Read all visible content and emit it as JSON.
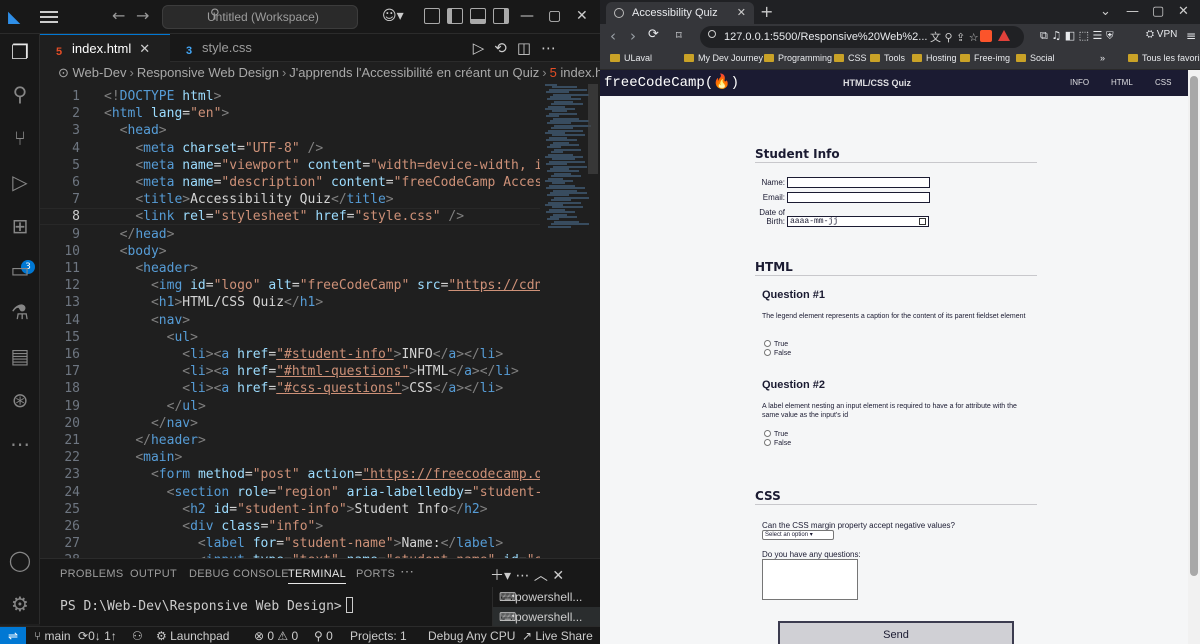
{
  "vscode": {
    "search_text": "Untitled (Workspace)",
    "tabs": [
      {
        "label": "index.html",
        "active": true
      },
      {
        "label": "style.css",
        "active": false
      }
    ],
    "breadcrumb": [
      "Web-Dev",
      "Responsive Web Design",
      "J'apprends l'Accessibilité en créant un Quiz",
      "index.html"
    ],
    "extensions_badge": "3",
    "current_line": 8,
    "code_lines": [
      {
        "n": "1",
        "parts": [
          [
            "br",
            "<!"
          ],
          [
            "tag",
            "DOCTYPE"
          ],
          [
            "txt",
            " "
          ],
          [
            "attr",
            "html"
          ],
          [
            "br",
            ">"
          ]
        ]
      },
      {
        "n": "2",
        "parts": [
          [
            "br",
            "<"
          ],
          [
            "tag",
            "html"
          ],
          [
            "txt",
            " "
          ],
          [
            "attr",
            "lang"
          ],
          [
            "txt",
            "="
          ],
          [
            "str",
            "\"en\""
          ],
          [
            "br",
            ">"
          ]
        ]
      },
      {
        "n": "3",
        "parts": [
          [
            "txt",
            "  "
          ],
          [
            "br",
            "<"
          ],
          [
            "tag",
            "head"
          ],
          [
            "br",
            ">"
          ]
        ]
      },
      {
        "n": "4",
        "parts": [
          [
            "txt",
            "    "
          ],
          [
            "br",
            "<"
          ],
          [
            "tag",
            "meta"
          ],
          [
            "txt",
            " "
          ],
          [
            "attr",
            "charset"
          ],
          [
            "txt",
            "="
          ],
          [
            "str",
            "\"UTF-8\""
          ],
          [
            "txt",
            " "
          ],
          [
            "br",
            "/>"
          ]
        ]
      },
      {
        "n": "5",
        "parts": [
          [
            "txt",
            "    "
          ],
          [
            "br",
            "<"
          ],
          [
            "tag",
            "meta"
          ],
          [
            "txt",
            " "
          ],
          [
            "attr",
            "name"
          ],
          [
            "txt",
            "="
          ],
          [
            "str",
            "\"viewport\""
          ],
          [
            "txt",
            " "
          ],
          [
            "attr",
            "content"
          ],
          [
            "txt",
            "="
          ],
          [
            "str",
            "\"width=device-width, initial-"
          ]
        ]
      },
      {
        "n": "6",
        "parts": [
          [
            "txt",
            "    "
          ],
          [
            "br",
            "<"
          ],
          [
            "tag",
            "meta"
          ],
          [
            "txt",
            " "
          ],
          [
            "attr",
            "name"
          ],
          [
            "txt",
            "="
          ],
          [
            "str",
            "\"description\""
          ],
          [
            "txt",
            " "
          ],
          [
            "attr",
            "content"
          ],
          [
            "txt",
            "="
          ],
          [
            "str",
            "\"freeCodeCamp Accessibilit"
          ]
        ]
      },
      {
        "n": "7",
        "parts": [
          [
            "txt",
            "    "
          ],
          [
            "br",
            "<"
          ],
          [
            "tag",
            "title"
          ],
          [
            "br",
            ">"
          ],
          [
            "txt",
            "Accessibility Quiz"
          ],
          [
            "br",
            "</"
          ],
          [
            "tag",
            "title"
          ],
          [
            "br",
            ">"
          ]
        ]
      },
      {
        "n": "8",
        "parts": [
          [
            "txt",
            "    "
          ],
          [
            "br",
            "<"
          ],
          [
            "tag",
            "link"
          ],
          [
            "txt",
            " "
          ],
          [
            "attr",
            "rel"
          ],
          [
            "txt",
            "="
          ],
          [
            "str",
            "\"stylesheet\""
          ],
          [
            "txt",
            " "
          ],
          [
            "attr",
            "href"
          ],
          [
            "txt",
            "="
          ],
          [
            "str",
            "\"style.css\""
          ],
          [
            "txt",
            " "
          ],
          [
            "br",
            "/>"
          ]
        ]
      },
      {
        "n": "9",
        "parts": [
          [
            "txt",
            "  "
          ],
          [
            "br",
            "</"
          ],
          [
            "tag",
            "head"
          ],
          [
            "br",
            ">"
          ]
        ]
      },
      {
        "n": "10",
        "parts": [
          [
            "txt",
            "  "
          ],
          [
            "br",
            "<"
          ],
          [
            "tag",
            "body"
          ],
          [
            "br",
            ">"
          ]
        ]
      },
      {
        "n": "11",
        "parts": [
          [
            "txt",
            "    "
          ],
          [
            "br",
            "<"
          ],
          [
            "tag",
            "header"
          ],
          [
            "br",
            ">"
          ]
        ]
      },
      {
        "n": "12",
        "parts": [
          [
            "txt",
            "      "
          ],
          [
            "br",
            "<"
          ],
          [
            "tag",
            "img"
          ],
          [
            "txt",
            " "
          ],
          [
            "attr",
            "id"
          ],
          [
            "txt",
            "="
          ],
          [
            "str",
            "\"logo\""
          ],
          [
            "txt",
            " "
          ],
          [
            "attr",
            "alt"
          ],
          [
            "txt",
            "="
          ],
          [
            "str",
            "\"freeCodeCamp\""
          ],
          [
            "txt",
            " "
          ],
          [
            "attr",
            "src"
          ],
          [
            "txt",
            "="
          ],
          [
            "url",
            "\"https://cdn.freeco"
          ]
        ]
      },
      {
        "n": "13",
        "parts": [
          [
            "txt",
            "      "
          ],
          [
            "br",
            "<"
          ],
          [
            "tag",
            "h1"
          ],
          [
            "br",
            ">"
          ],
          [
            "txt",
            "HTML/CSS Quiz"
          ],
          [
            "br",
            "</"
          ],
          [
            "tag",
            "h1"
          ],
          [
            "br",
            ">"
          ]
        ]
      },
      {
        "n": "14",
        "parts": [
          [
            "txt",
            "      "
          ],
          [
            "br",
            "<"
          ],
          [
            "tag",
            "nav"
          ],
          [
            "br",
            ">"
          ]
        ]
      },
      {
        "n": "15",
        "parts": [
          [
            "txt",
            "        "
          ],
          [
            "br",
            "<"
          ],
          [
            "tag",
            "ul"
          ],
          [
            "br",
            ">"
          ]
        ]
      },
      {
        "n": "16",
        "parts": [
          [
            "txt",
            "          "
          ],
          [
            "br",
            "<"
          ],
          [
            "tag",
            "li"
          ],
          [
            "br",
            "><"
          ],
          [
            "tag",
            "a"
          ],
          [
            "txt",
            " "
          ],
          [
            "attr",
            "href"
          ],
          [
            "txt",
            "="
          ],
          [
            "url",
            "\"#student-info\""
          ],
          [
            "br",
            ">"
          ],
          [
            "txt",
            "INFO"
          ],
          [
            "br",
            "</"
          ],
          [
            "tag",
            "a"
          ],
          [
            "br",
            "></"
          ],
          [
            "tag",
            "li"
          ],
          [
            "br",
            ">"
          ]
        ]
      },
      {
        "n": "17",
        "parts": [
          [
            "txt",
            "          "
          ],
          [
            "br",
            "<"
          ],
          [
            "tag",
            "li"
          ],
          [
            "br",
            "><"
          ],
          [
            "tag",
            "a"
          ],
          [
            "txt",
            " "
          ],
          [
            "attr",
            "href"
          ],
          [
            "txt",
            "="
          ],
          [
            "url",
            "\"#html-questions\""
          ],
          [
            "br",
            ">"
          ],
          [
            "txt",
            "HTML"
          ],
          [
            "br",
            "</"
          ],
          [
            "tag",
            "a"
          ],
          [
            "br",
            "></"
          ],
          [
            "tag",
            "li"
          ],
          [
            "br",
            ">"
          ]
        ]
      },
      {
        "n": "18",
        "parts": [
          [
            "txt",
            "          "
          ],
          [
            "br",
            "<"
          ],
          [
            "tag",
            "li"
          ],
          [
            "br",
            "><"
          ],
          [
            "tag",
            "a"
          ],
          [
            "txt",
            " "
          ],
          [
            "attr",
            "href"
          ],
          [
            "txt",
            "="
          ],
          [
            "url",
            "\"#css-questions\""
          ],
          [
            "br",
            ">"
          ],
          [
            "txt",
            "CSS"
          ],
          [
            "br",
            "</"
          ],
          [
            "tag",
            "a"
          ],
          [
            "br",
            "></"
          ],
          [
            "tag",
            "li"
          ],
          [
            "br",
            ">"
          ]
        ]
      },
      {
        "n": "19",
        "parts": [
          [
            "txt",
            "        "
          ],
          [
            "br",
            "</"
          ],
          [
            "tag",
            "ul"
          ],
          [
            "br",
            ">"
          ]
        ]
      },
      {
        "n": "20",
        "parts": [
          [
            "txt",
            "      "
          ],
          [
            "br",
            "</"
          ],
          [
            "tag",
            "nav"
          ],
          [
            "br",
            ">"
          ]
        ]
      },
      {
        "n": "21",
        "parts": [
          [
            "txt",
            "    "
          ],
          [
            "br",
            "</"
          ],
          [
            "tag",
            "header"
          ],
          [
            "br",
            ">"
          ]
        ]
      },
      {
        "n": "22",
        "parts": [
          [
            "txt",
            "    "
          ],
          [
            "br",
            "<"
          ],
          [
            "tag",
            "main"
          ],
          [
            "br",
            ">"
          ]
        ]
      },
      {
        "n": "23",
        "parts": [
          [
            "txt",
            "      "
          ],
          [
            "br",
            "<"
          ],
          [
            "tag",
            "form"
          ],
          [
            "txt",
            " "
          ],
          [
            "attr",
            "method"
          ],
          [
            "txt",
            "="
          ],
          [
            "str",
            "\"post\""
          ],
          [
            "txt",
            " "
          ],
          [
            "attr",
            "action"
          ],
          [
            "txt",
            "="
          ],
          [
            "url",
            "\"https://freecodecamp.org/prac"
          ]
        ]
      },
      {
        "n": "24",
        "parts": [
          [
            "txt",
            "        "
          ],
          [
            "br",
            "<"
          ],
          [
            "tag",
            "section"
          ],
          [
            "txt",
            " "
          ],
          [
            "attr",
            "role"
          ],
          [
            "txt",
            "="
          ],
          [
            "str",
            "\"region\""
          ],
          [
            "txt",
            " "
          ],
          [
            "attr",
            "aria-labelledby"
          ],
          [
            "txt",
            "="
          ],
          [
            "str",
            "\"student-info\""
          ],
          [
            "br",
            ">"
          ]
        ]
      },
      {
        "n": "25",
        "parts": [
          [
            "txt",
            "          "
          ],
          [
            "br",
            "<"
          ],
          [
            "tag",
            "h2"
          ],
          [
            "txt",
            " "
          ],
          [
            "attr",
            "id"
          ],
          [
            "txt",
            "="
          ],
          [
            "str",
            "\"student-info\""
          ],
          [
            "br",
            ">"
          ],
          [
            "txt",
            "Student Info"
          ],
          [
            "br",
            "</"
          ],
          [
            "tag",
            "h2"
          ],
          [
            "br",
            ">"
          ]
        ]
      },
      {
        "n": "26",
        "parts": [
          [
            "txt",
            "          "
          ],
          [
            "br",
            "<"
          ],
          [
            "tag",
            "div"
          ],
          [
            "txt",
            " "
          ],
          [
            "attr",
            "class"
          ],
          [
            "txt",
            "="
          ],
          [
            "str",
            "\"info\""
          ],
          [
            "br",
            ">"
          ]
        ]
      },
      {
        "n": "27",
        "parts": [
          [
            "txt",
            "            "
          ],
          [
            "br",
            "<"
          ],
          [
            "tag",
            "label"
          ],
          [
            "txt",
            " "
          ],
          [
            "attr",
            "for"
          ],
          [
            "txt",
            "="
          ],
          [
            "str",
            "\"student-name\""
          ],
          [
            "br",
            ">"
          ],
          [
            "txt",
            "Name:"
          ],
          [
            "br",
            "</"
          ],
          [
            "tag",
            "label"
          ],
          [
            "br",
            ">"
          ]
        ]
      },
      {
        "n": "28",
        "parts": [
          [
            "txt",
            "            "
          ],
          [
            "br",
            "<"
          ],
          [
            "tag",
            "input"
          ],
          [
            "txt",
            " "
          ],
          [
            "attr",
            "type"
          ],
          [
            "txt",
            "="
          ],
          [
            "str",
            "\"text\""
          ],
          [
            "txt",
            " "
          ],
          [
            "attr",
            "name"
          ],
          [
            "txt",
            "="
          ],
          [
            "str",
            "\"student-name\""
          ],
          [
            "txt",
            " "
          ],
          [
            "attr",
            "id"
          ],
          [
            "txt",
            "="
          ],
          [
            "str",
            "\"student-"
          ]
        ]
      }
    ],
    "panel_tabs": [
      "PROBLEMS",
      "OUTPUT",
      "DEBUG CONSOLE",
      "TERMINAL",
      "PORTS"
    ],
    "active_panel_tab": "TERMINAL",
    "terminal_prompt": "PS D:\\Web-Dev\\Responsive Web Design>",
    "terminals": [
      "powershell...",
      "powershell..."
    ],
    "status": {
      "branch": "main",
      "sync": "0↓ 1↑",
      "launchpad": "Launchpad",
      "errors": "0",
      "warnings": "0",
      "ports": "0",
      "projects": "Projects: 1",
      "debug": "Debug Any CPU",
      "live_share": "Live Share"
    }
  },
  "browser": {
    "tab_title": "Accessibility Quiz",
    "url": "127.0.0.1:5500/Responsive%20Web%2...",
    "vpn_label": "VPN",
    "bookmarks": [
      "ULaval",
      "My Dev Journey",
      "Programming",
      "CSS",
      "Tools",
      "Hosting",
      "Free-img",
      "Social"
    ],
    "all_bookmarks": "Tous les favoris",
    "page": {
      "logo": "freeCodeCamp(🔥)",
      "title": "HTML/CSS Quiz",
      "nav": [
        "INFO",
        "HTML",
        "CSS"
      ],
      "student_heading": "Student Info",
      "name_label": "Name:",
      "email_label": "Email:",
      "dob_label_1": "Date of",
      "dob_label_2": "Birth:",
      "dob_placeholder": "aaaa-mm-jj",
      "html_heading": "HTML",
      "q1_title": "Question #1",
      "q1_text": "The legend element represents a caption for the content of its parent fieldset element",
      "q2_title": "Question #2",
      "q2_text": "A label element nesting an input element is required to have a for attribute with the same value as the input's id",
      "true_label": "True",
      "false_label": "False",
      "css_heading": "CSS",
      "css_q1": "Can the CSS margin property accept negative values?",
      "select_value": "Select an option",
      "questions_label": "Do you have any questions:",
      "send_label": "Send"
    }
  }
}
